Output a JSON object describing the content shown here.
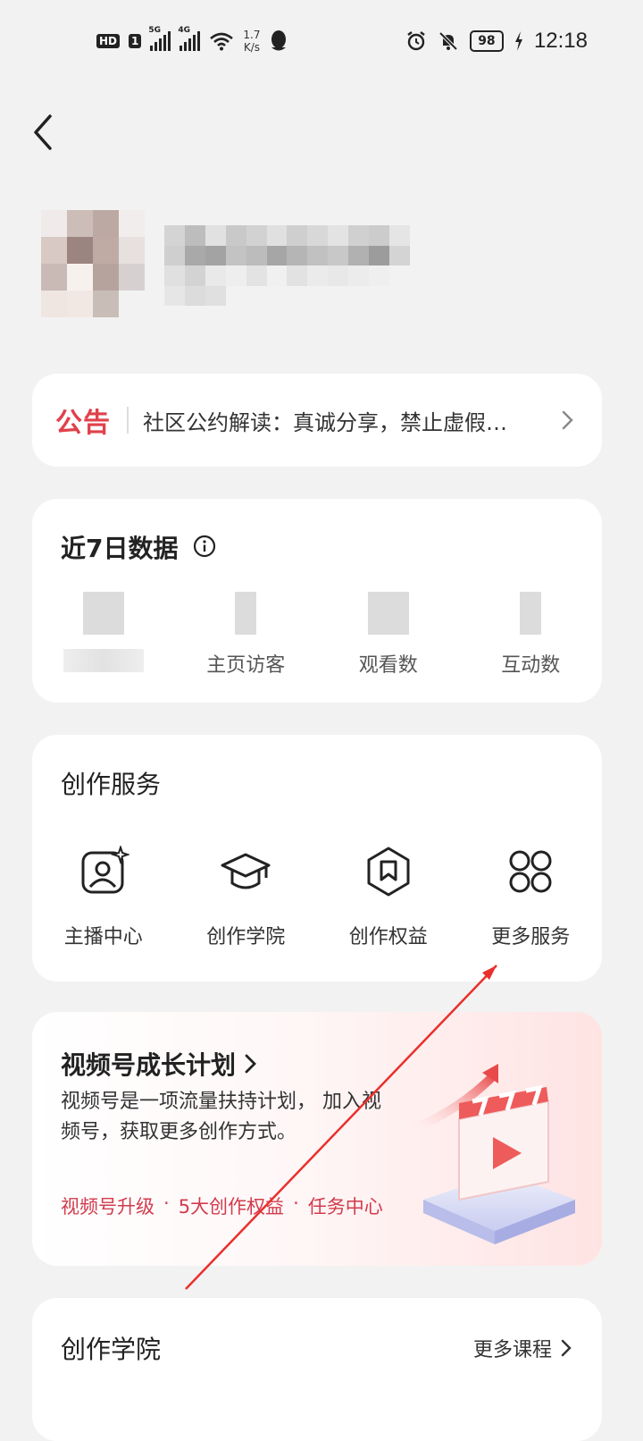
{
  "status_bar": {
    "hd_badge": "HD",
    "sim_badge": "1",
    "net1": "5G",
    "net2": "4G",
    "speed_value": "1.7",
    "speed_unit": "K/s",
    "battery": "98",
    "time": "12:18"
  },
  "notice": {
    "tag": "公告",
    "text": "社区公约解读：真诚分享，禁止虚假…"
  },
  "data_section": {
    "title": "近7日数据",
    "stats": [
      {
        "label": ""
      },
      {
        "label": "主页访客"
      },
      {
        "label": "观看数"
      },
      {
        "label": "互动数"
      }
    ]
  },
  "services": {
    "title": "创作服务",
    "items": [
      {
        "label": "主播中心",
        "icon": "anchor-center-icon"
      },
      {
        "label": "创作学院",
        "icon": "graduation-cap-icon"
      },
      {
        "label": "创作权益",
        "icon": "benefit-badge-icon"
      },
      {
        "label": "更多服务",
        "icon": "grid-four-circles-icon"
      }
    ]
  },
  "growth": {
    "title": "视频号成长计划",
    "description": "视频号是一项流量扶持计划， 加入视频号，获取更多创作方式。",
    "links": [
      "视频号升级",
      "5大创作权益",
      "任务中心"
    ]
  },
  "academy": {
    "title": "创作学院",
    "more": "更多课程"
  },
  "colors": {
    "accent_red": "#e0414b",
    "link_red": "#d23c4e",
    "page_bg": "#f2f2f2",
    "card_bg": "#ffffff"
  }
}
